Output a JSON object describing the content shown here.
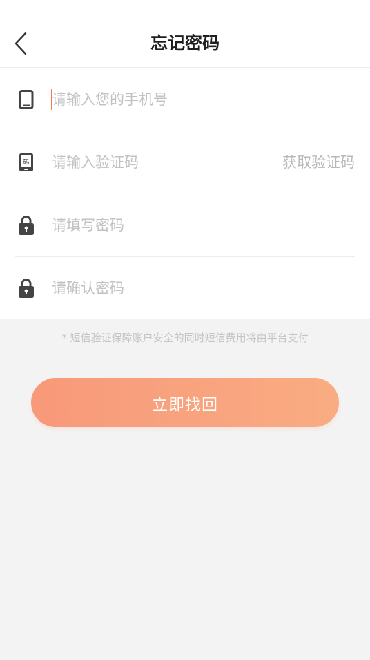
{
  "header": {
    "title": "忘记密码",
    "back_icon": "chevron-left-icon"
  },
  "form": {
    "phone": {
      "placeholder": "请输入您的手机号",
      "value": "",
      "icon": "phone-icon"
    },
    "code": {
      "placeholder": "请输入验证码",
      "value": "",
      "icon": "sms-code-icon",
      "get_code_label": "获取验证码"
    },
    "password": {
      "placeholder": "请填写密码",
      "value": "",
      "icon": "lock-icon"
    },
    "confirm": {
      "placeholder": "请确认密码",
      "value": "",
      "icon": "lock-icon"
    }
  },
  "notice": "* 短信验证保障账户安全的同时短信费用将由平台支付",
  "submit_label": "立即找回",
  "colors": {
    "accent": "#f07b4b",
    "button_start": "#f8997a",
    "button_end": "#f9ac82",
    "background": "#f4f3f3"
  }
}
